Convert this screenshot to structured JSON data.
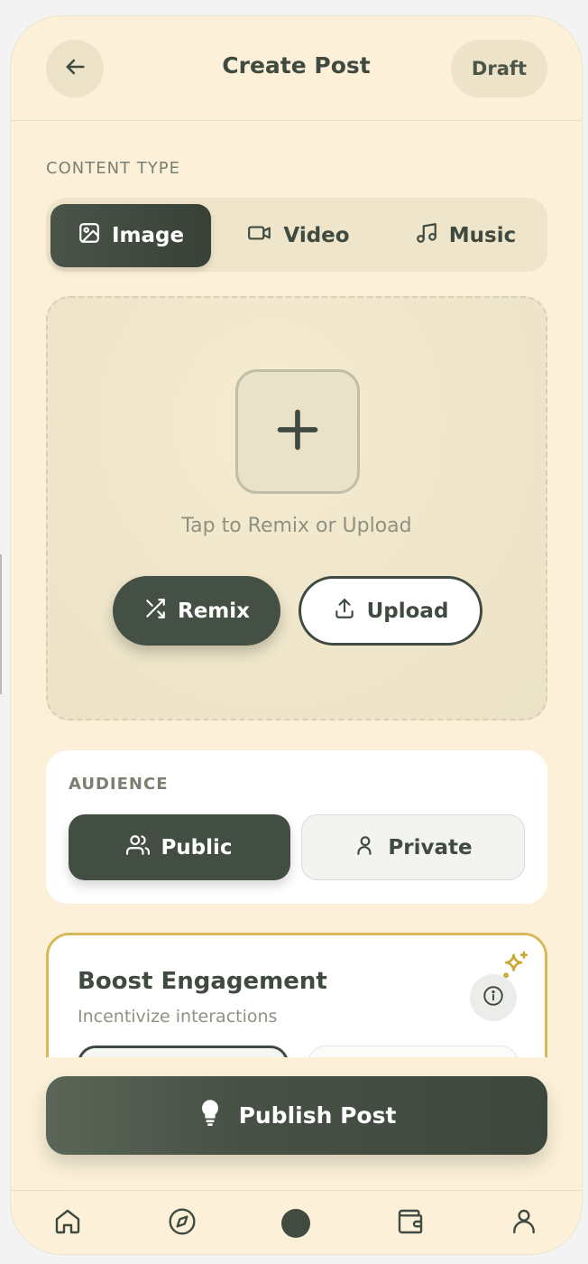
{
  "header": {
    "title": "Create Post",
    "draft_label": "Draft"
  },
  "content_type": {
    "label": "CONTENT TYPE",
    "options": [
      {
        "label": "Image",
        "icon": "image-icon",
        "selected": true
      },
      {
        "label": "Video",
        "icon": "video-icon",
        "selected": false
      },
      {
        "label": "Music",
        "icon": "music-icon",
        "selected": false
      }
    ]
  },
  "upload": {
    "hint": "Tap to Remix or Upload",
    "remix_label": "Remix",
    "upload_label": "Upload"
  },
  "audience": {
    "label": "AUDIENCE",
    "options": [
      {
        "label": "Public",
        "icon": "users-icon",
        "selected": true
      },
      {
        "label": "Private",
        "icon": "user-icon",
        "selected": false
      }
    ]
  },
  "boost": {
    "title": "Boost Engagement",
    "subtitle": "Incentivize interactions"
  },
  "publish": {
    "label": "Publish Post",
    "icon": "lightbulb-icon"
  },
  "nav": {
    "items": [
      "home-icon",
      "compass-icon",
      "create-icon",
      "wallet-icon",
      "profile-icon"
    ],
    "active": "create-icon"
  },
  "colors": {
    "background": "#fcf1d8",
    "primary": "#3f4a40",
    "accent": "#d5b95a",
    "muted": "#8f9180"
  }
}
